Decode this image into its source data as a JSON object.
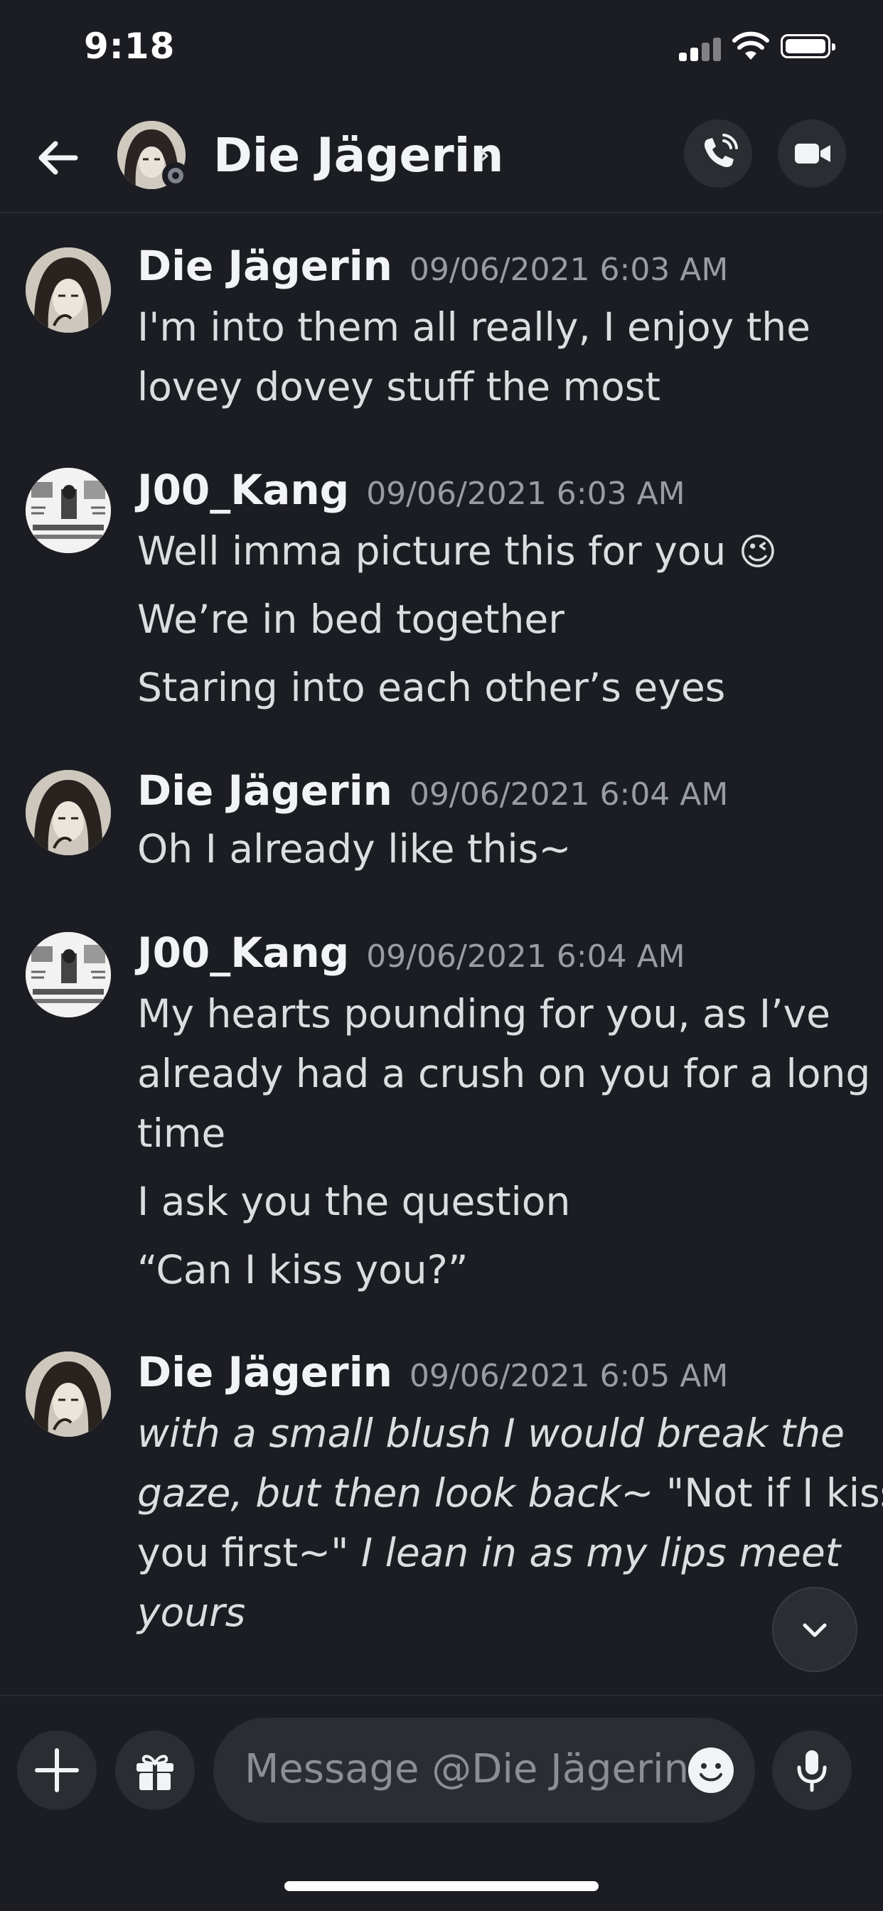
{
  "status_bar": {
    "time": "9:18"
  },
  "header": {
    "title": "Die Jägerin",
    "chevron": "›"
  },
  "messages": [
    {
      "author": "Die Jägerin",
      "timestamp": "09/06/2021 6:03 AM",
      "lines": [
        "I'm into them all really, I enjoy the",
        "lovey dovey stuff the most"
      ]
    },
    {
      "author": "J00_Kang",
      "timestamp": "09/06/2021 6:03 AM",
      "lines": [
        "Well imma picture this for you",
        "We’re in bed together",
        "Staring into each other’s eyes"
      ],
      "emoji": "😉"
    },
    {
      "author": "Die Jägerin",
      "timestamp": "09/06/2021 6:04 AM",
      "lines": [
        "Oh I already like this~"
      ]
    },
    {
      "author": "J00_Kang",
      "timestamp": "09/06/2021 6:04 AM",
      "lines": [
        "My hearts pounding for you, as I’ve",
        "already had a crush on you for a long",
        "time",
        "I ask you the question",
        "“Can I kiss you?”"
      ]
    },
    {
      "author": "Die Jägerin",
      "timestamp": "09/06/2021 6:05 AM",
      "lines": [
        "with a small blush I would break the",
        "gaze, but then look back~",
        " \"Not if I kiss",
        "you first~\"",
        " I lean in as my lips meet",
        "yours"
      ]
    }
  ],
  "composer": {
    "placeholder": "Message @Die Jägerin"
  },
  "icons": {
    "back": "arrow-left-icon",
    "call": "phone-call-icon",
    "video": "video-camera-icon",
    "scroll": "chevron-down-icon",
    "plus": "plus-icon",
    "gift": "gift-icon",
    "emoji": "smiley-icon",
    "mic": "microphone-icon"
  },
  "colors": {
    "background": "#1c1d22",
    "surface": "#2b2d33",
    "text": "#dbdee1",
    "muted": "#9a9ca3"
  }
}
